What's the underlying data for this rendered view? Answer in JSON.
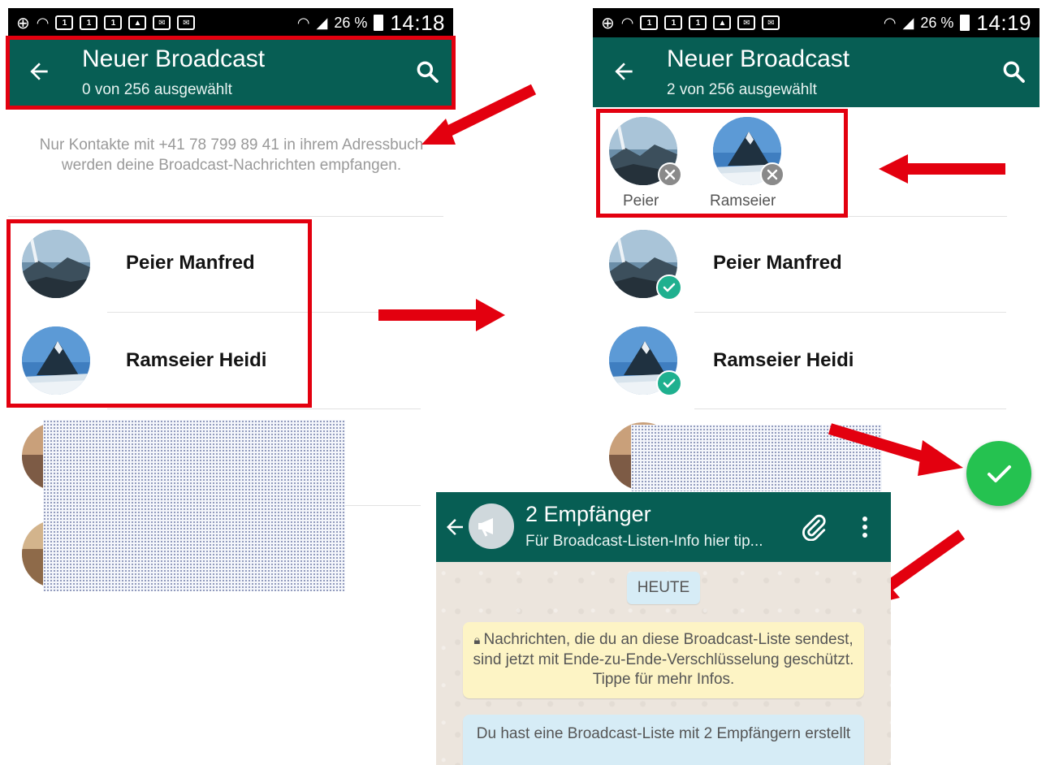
{
  "left_screen": {
    "status": {
      "battery": "26 %",
      "time": "14:18"
    },
    "header": {
      "title": "Neuer Broadcast",
      "subtitle": "0 von 256 ausgewählt"
    },
    "notice": "Nur Kontakte mit +41 78 799 89 41 in ihrem Adressbuch werden deine Broadcast-Nachrichten empfangen.",
    "contacts": [
      {
        "name": "Peier Manfred",
        "selected": false
      },
      {
        "name": "Ramseier Heidi",
        "selected": false
      }
    ]
  },
  "right_screen": {
    "status": {
      "battery": "26 %",
      "time": "14:19"
    },
    "header": {
      "title": "Neuer Broadcast",
      "subtitle": "2 von 256 ausgewählt"
    },
    "selected_chips": [
      {
        "label": "Peier"
      },
      {
        "label": "Ramseier"
      }
    ],
    "contacts": [
      {
        "name": "Peier Manfred",
        "selected": true
      },
      {
        "name": "Ramseier Heidi",
        "selected": true
      }
    ]
  },
  "chat": {
    "title": "2 Empfänger",
    "subtitle": "Für Broadcast-Listen-Info hier tip...",
    "date_label": "HEUTE",
    "encryption_notice": "Nachrichten, die du an diese Broadcast-Liste sendest, sind jetzt mit Ende-zu-Ende-Verschlüsselung geschützt. Tippe für mehr Infos.",
    "info_message": "Du hast eine Broadcast-Liste mit 2 Empfängern erstellt"
  },
  "colors": {
    "header": "#075e54",
    "highlight": "#e3000f",
    "fab": "#25c250",
    "check_badge": "#1fb08f"
  }
}
